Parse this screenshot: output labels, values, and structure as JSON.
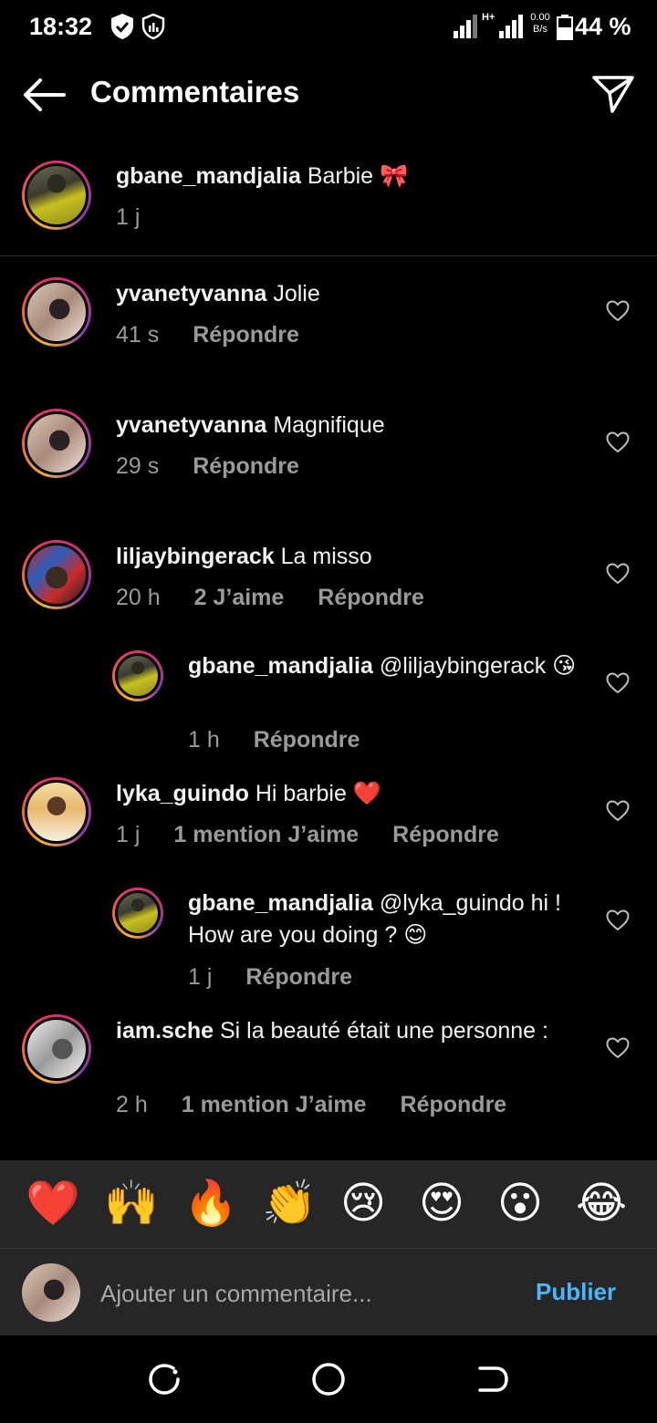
{
  "status": {
    "time": "18:32",
    "network_type": "H+",
    "speed_value": "0.00",
    "speed_unit": "B/s",
    "battery": "44 %"
  },
  "header": {
    "title": "Commentaires",
    "back_icon": "arrow-left-icon",
    "share_icon": "paper-plane-icon"
  },
  "caption": {
    "user": "gbane_mandjalia",
    "text": "Barbie 🎀",
    "time": "1 j"
  },
  "labels": {
    "reply": "Répondre"
  },
  "comments": [
    {
      "user": "yvanetyvanna",
      "text": "Jolie",
      "time": "41 s",
      "likes": ""
    },
    {
      "user": "yvanetyvanna",
      "text": "Magnifique",
      "time": "29 s",
      "likes": ""
    },
    {
      "user": "liljaybingerack",
      "text": "La misso",
      "time": "20 h",
      "likes": "2 J’aime",
      "reply": {
        "user": "gbane_mandjalia",
        "text": "@liljaybingerack 😘",
        "time": "1 h",
        "likes": ""
      }
    },
    {
      "user": "lyka_guindo",
      "text": "Hi barbie ❤️",
      "time": "1 j",
      "likes": "1 mention J’aime",
      "reply": {
        "user": "gbane_mandjalia",
        "text": "@lyka_guindo hi ! How are you doing ? 😊",
        "time": "1 j",
        "likes": ""
      }
    },
    {
      "user": "iam.sche",
      "text": "Si la beauté était une personne :",
      "time": "2 h",
      "likes": "1 mention J’aime"
    }
  ],
  "quick_reactions": [
    "❤️",
    "🙌",
    "🔥",
    "👏",
    "😢",
    "😍",
    "😮",
    "😂"
  ],
  "composer": {
    "placeholder": "Ajouter un commentaire...",
    "publish": "Publier"
  },
  "colors": {
    "background": "#000000",
    "secondary_text": "#9a9a9a",
    "publish_blue": "#4cb5f9",
    "panel": "#262626"
  }
}
